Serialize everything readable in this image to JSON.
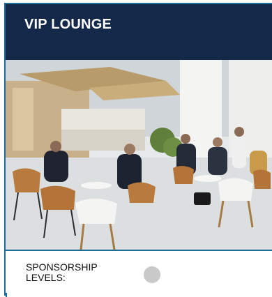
{
  "card": {
    "title": "VIP LOUNGE",
    "photo_icon": "lounge-photo",
    "sponsorship_label": "SPONSORSHIP LEVELS:",
    "level_indicator_icon": "circle-icon",
    "colors": {
      "header_bg": "#14294a",
      "border": "#1d6f95",
      "level_dot": "#c9c9c9"
    }
  }
}
